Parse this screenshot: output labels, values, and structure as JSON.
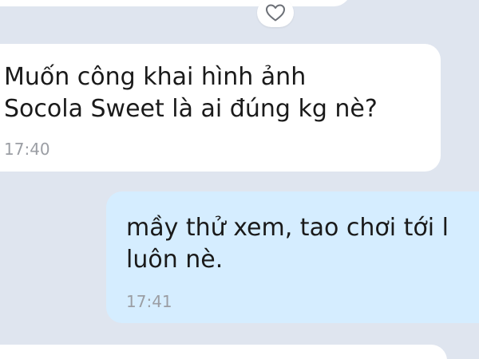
{
  "colors": {
    "background": "#dfe5ef",
    "incoming_bubble": "#ffffff",
    "outgoing_bubble": "#d5edff",
    "timestamp": "#9b9ea4"
  },
  "reaction_icon": "heart-outline-icon",
  "messages": [
    {
      "direction": "incoming",
      "text": "Muốn công khai hình ảnh\nSocola Sweet là ai đúng kg nè?",
      "time": "17:40"
    },
    {
      "direction": "outgoing",
      "text": "mầy thử xem, tao chơi tới l\nluôn nè.",
      "time": "17:41"
    }
  ]
}
